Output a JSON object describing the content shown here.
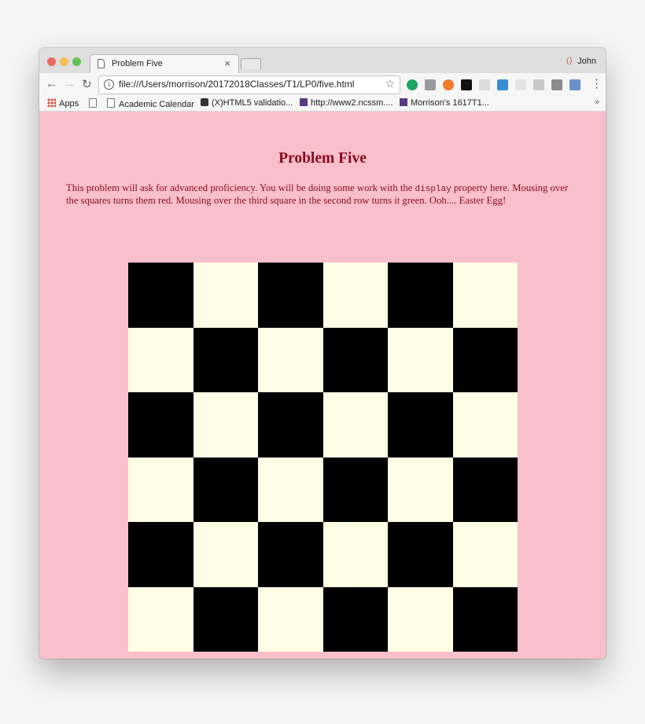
{
  "browser": {
    "tab_title": "Problem Five",
    "tab_close": "×",
    "profile_name": "John",
    "url": "file:///Users/morrison/20172018Classes/T1/LP0/five.html",
    "bookmarks": [
      {
        "label": "Apps"
      },
      {
        "label": ""
      },
      {
        "label": "Academic Calendar"
      },
      {
        "label": "(X)HTML5 validatio..."
      },
      {
        "label": "http://www2.ncssm...."
      },
      {
        "label": "Morrison's 1617T1..."
      }
    ],
    "more_bookmarks": "»"
  },
  "page": {
    "title": "Problem Five",
    "paragraph_before_code": "This problem will ask for advanced proficiency. You will be doing some work with the ",
    "paragraph_code": "display",
    "paragraph_after_code": " property here. Mousing over the squares turns them red. Mousing over the third square in the second row turns it green. Ooh.... Easter Egg!"
  },
  "board": {
    "rows": 6,
    "cols": 6,
    "dark_color": "#000000",
    "light_color": "#fffde6"
  },
  "colors": {
    "page_background": "#f9bfca",
    "title_color": "#8b0a1f"
  }
}
